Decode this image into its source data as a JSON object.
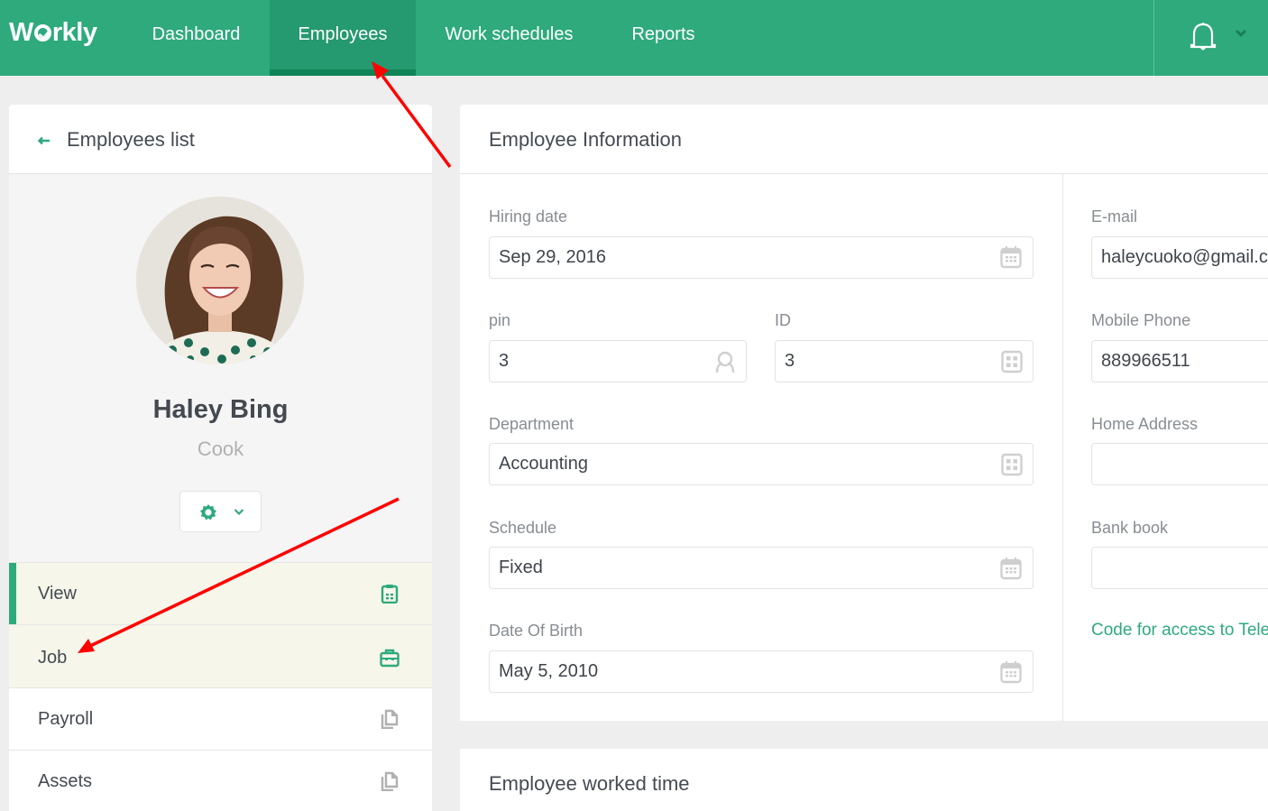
{
  "app": {
    "logo_text": "Wrkly",
    "brand_color": "#2eaa7d"
  },
  "nav": {
    "items": [
      {
        "label": "Dashboard",
        "active": false
      },
      {
        "label": "Employees",
        "active": true
      },
      {
        "label": "Work schedules",
        "active": false
      },
      {
        "label": "Reports",
        "active": false
      }
    ],
    "notification_icon": "bell-icon",
    "user_menu_icon": "chevron-down-icon"
  },
  "left_panel": {
    "back_label": "Employees list",
    "employee": {
      "name": "Haley Bing",
      "role": "Cook",
      "avatar": "employee-photo"
    },
    "actions_button": {
      "icon": "gear-icon",
      "dropdown_icon": "chevron-down-icon"
    },
    "menu": [
      {
        "label": "View",
        "icon": "clipboard-icon",
        "selected": true
      },
      {
        "label": "Job",
        "icon": "briefcase-icon",
        "selected": false
      },
      {
        "label": "Payroll",
        "icon": "documents-icon",
        "selected": false
      },
      {
        "label": "Assets",
        "icon": "documents-icon",
        "selected": false
      }
    ]
  },
  "info": {
    "title": "Employee Information",
    "fields": {
      "hiring_date": {
        "label": "Hiring date",
        "value": "Sep 29, 2016",
        "icon": "calendar-icon"
      },
      "pin": {
        "label": "pin",
        "value": "3",
        "icon": "user-icon"
      },
      "id": {
        "label": "ID",
        "value": "3",
        "icon": "grid-icon"
      },
      "department": {
        "label": "Department",
        "value": "Accounting",
        "icon": "grid-icon"
      },
      "schedule": {
        "label": "Schedule",
        "value": "Fixed",
        "icon": "calendar-icon"
      },
      "date_of_birth": {
        "label": "Date Of Birth",
        "value": "May 5, 2010",
        "icon": "calendar-icon"
      },
      "email": {
        "label": "E-mail",
        "value": "haleycuoko@gmail.com"
      },
      "mobile_phone": {
        "label": "Mobile Phone",
        "value": "889966511"
      },
      "home_address": {
        "label": "Home Address",
        "value": ""
      },
      "bank_book": {
        "label": "Bank book",
        "value": ""
      }
    },
    "telegram_link": "Code for access to Telegram"
  },
  "worked_time": {
    "title": "Employee worked time"
  }
}
